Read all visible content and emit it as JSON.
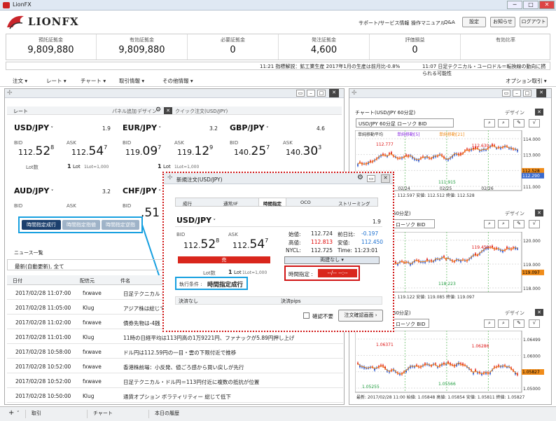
{
  "window": {
    "title": "LionFX",
    "min": "─",
    "max": "□",
    "close": "✕"
  },
  "brand": {
    "name": "LIONFX"
  },
  "toplinks": [
    "サポート/サービス情報",
    "操作マニュアル",
    "Q&A"
  ],
  "topbuttons": [
    "設定",
    "お知らせ",
    "ログアウト"
  ],
  "account": [
    {
      "label": "預託証拠金",
      "value": "9,809,880"
    },
    {
      "label": "有効証拠金",
      "value": "9,809,880"
    },
    {
      "label": "必要証拠金",
      "value": "0"
    },
    {
      "label": "発注証拠金",
      "value": "4,600"
    },
    {
      "label": "評価損益",
      "value": "0"
    },
    {
      "label": "有効比率",
      "value": ""
    }
  ],
  "ticker": {
    "a": "11:21  指標解説：鉱工業生産 2017年1月の生産は前月比-0.8%",
    "b": "11:07  日足テクニカル・ユーロドル＝転換線の動向に撚られる可能性"
  },
  "menu": [
    "注文",
    "レート",
    "チャート",
    "取引情報",
    "その他情報"
  ],
  "menu_right": "オプション取引",
  "rate": {
    "title": "レート",
    "panel_add": "パネル追加",
    "design": "デザイン",
    "quick": "クイック注文(USD/JPY)",
    "pairs": [
      {
        "name": "USD/JPY",
        "spread": "1.9",
        "bid_a": "112.",
        "bid_b": "52",
        "bid_c": "8",
        "ask_a": "112.",
        "ask_b": "54",
        "ask_c": "7",
        "lot": "1",
        "lotnote": "1Lot=1,000"
      },
      {
        "name": "EUR/JPY",
        "spread": "3.2",
        "bid_a": "119.",
        "bid_b": "09",
        "bid_c": "7",
        "ask_a": "119.",
        "ask_b": "12",
        "ask_c": "9",
        "lot": "1",
        "lotnote": "1Lot=1,000"
      },
      {
        "name": "GBP/JPY",
        "spread": "4.6",
        "bid_a": "140.",
        "bid_b": "25",
        "bid_c": "7",
        "ask_a": "140.",
        "ask_b": "30",
        "ask_c": "3",
        "lot": "",
        "lotnote": ""
      },
      {
        "name": "AUD/JPY",
        "spread": "3.2",
        "bid_a": "",
        "bid_b": "",
        "bid_c": "",
        "ask_a": "",
        "ask_b": "",
        "ask_c": "",
        "lot": "",
        "lotnote": ""
      },
      {
        "name": "CHF/JPY",
        "spread": "",
        "bid_a": "",
        "bid_b": ".51",
        "bid_c": "",
        "ask_a": "",
        "ask_b": "",
        "ask_c": "",
        "lot": "",
        "lotnote": ""
      }
    ],
    "bid": "BID",
    "ask": "ASK",
    "lotlabel": "Lot数",
    "lotunit": "Lot"
  },
  "condbtns": [
    "時間指定成行",
    "時間指定指値",
    "時間指定逆指"
  ],
  "news": {
    "title": "ニュース一覧",
    "filter": "最新(自動更新), 全て",
    "cols": [
      "日付",
      "配信元",
      "件名"
    ],
    "rows": [
      {
        "d": "2017/02/28 11:07:00",
        "s": "fxwave",
        "t": "日足テクニカル・ユー"
      },
      {
        "d": "2017/02/28 11:05:00",
        "s": "Klug",
        "t": "アジア株は総じて軟"
      },
      {
        "d": "2017/02/28 11:02:00",
        "s": "fxwave",
        "t": "債券先物は-4銭"
      },
      {
        "d": "2017/02/28 11:01:00",
        "s": "Klug",
        "t": "11時の日経平均は113円高の1万9221円、ファナックが5.89円押し上げ"
      },
      {
        "d": "2017/02/28 10:58:00",
        "s": "fxwave",
        "t": "ドル円は112.59円の一目・雲の下限付近で推移"
      },
      {
        "d": "2017/02/28 10:52:00",
        "s": "fxwave",
        "t": "香港株前場：小反発、値ごろ感から買い戻しが先行"
      },
      {
        "d": "2017/02/28 10:52:00",
        "s": "fxwave",
        "t": "日足テクニカル・ドル円＝113円付近に複数の抵抗が位置"
      },
      {
        "d": "2017/02/28 10:50:00",
        "s": "Klug",
        "t": "通貨オプション ボラティリティー 総じて低下"
      }
    ]
  },
  "charts": [
    {
      "title": "チャート(USD/JPY 60分足)",
      "sel": "USD/JPY 60分足 ローソク BID",
      "design": "デザイン",
      "leg1": "単純移動平均",
      "leg2": "単純移動[5]",
      "leg3": "単純移動[21]",
      "hi": "112.777",
      "hi2": "112.630",
      "lo": "111.915",
      "yl": [
        "114.000",
        "113.000",
        "112.000",
        "111.000"
      ],
      "cur1": "112.528",
      "cur2": "112.290",
      "dates": [
        "02/24",
        "02/25",
        "02/26"
      ],
      "foot": "始値: 112.524  高値: 112.597  安値: 112.512  終値: 112.528"
    },
    {
      "title": "60分足)",
      "sel": "ローソク BID",
      "design": "デザイン",
      "leg1": "",
      "leg2": "",
      "leg3": "",
      "hi": "",
      "hi2": "119.450",
      "lo": "118.223",
      "yl": [
        "120.000",
        "119.000",
        "118.000"
      ],
      "cur1": "119.097",
      "cur2": "",
      "dates": [],
      "foot": "安値: 119.090  高値: 119.122  安値: 119.085  終値: 119.097"
    },
    {
      "title": "60分足)",
      "sel": "ローソク BID",
      "design": "デザイン",
      "leg1": "",
      "leg2": "",
      "leg3": "",
      "hi": "1.06371",
      "hi2": "1.06286",
      "lo": "1.05566",
      "lo2": "1.05255",
      "yl": [
        "1.06499",
        "1.06000",
        "1.05500",
        "1.05000"
      ],
      "cur1": "1.05827",
      "cur2": "",
      "dates": [],
      "foot": "最新: 2017/02/28 11:00  始値: 1.05848  高値: 1.05854  安値: 1.05811  終値: 1.05827"
    }
  ],
  "order": {
    "title": "新規注文(USD/JPY)",
    "tabs": [
      "成行",
      "通常/IF",
      "時間指定",
      "OCO",
      "ストリーミング"
    ],
    "pair": "USD/JPY",
    "spread": "1.9",
    "bid": "BID",
    "ask": "ASK",
    "bid_a": "112.",
    "bid_b": "52",
    "bid_c": "8",
    "ask_a": "112.",
    "ask_b": "54",
    "ask_c": "7",
    "stats": [
      {
        "l": "始値:",
        "v": "112.724"
      },
      {
        "l": "前日比:",
        "v": "-0.197"
      },
      {
        "l": "高値:",
        "v": "112.813"
      },
      {
        "l": "安値:",
        "v": "112.450"
      },
      {
        "l": "NYCL:",
        "v": "112.725"
      },
      {
        "l": "Time:",
        "v": "11:23:01"
      }
    ],
    "sell": "売",
    "buy": "両建なし",
    "lot": "Lot数",
    "lotv": "1",
    "lotunit": "Lot",
    "lotnote": "1Lot=1,000",
    "cond_label": "執行条件 :",
    "cond_value": "時間指定成行",
    "time_label": "時間指定 :",
    "time_value": "--/-- --:--",
    "settle1": "決済なし",
    "settle2": "決済pips",
    "confirm": "確認不要",
    "confirm_btn": "注文確認画面"
  },
  "bottom": [
    "取引",
    "チャート",
    "本日の履歴"
  ]
}
